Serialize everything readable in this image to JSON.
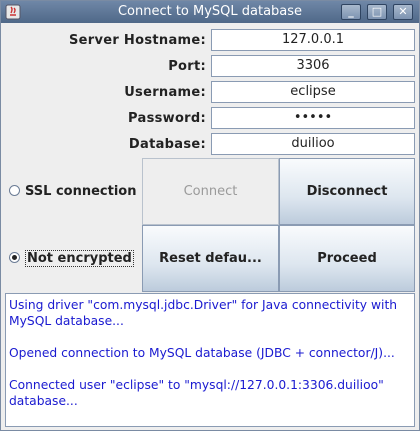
{
  "window": {
    "title": "Connect to MySQL database",
    "minimize": "_",
    "maximize": "□",
    "close": "✕"
  },
  "form": {
    "hostname_label": "Server Hostname:",
    "hostname_value": "127.0.0.1",
    "port_label": "Port:",
    "port_value": "3306",
    "username_label": "Username:",
    "username_value": "eclipse",
    "password_label": "Password:",
    "password_value": "•••••",
    "database_label": "Database:",
    "database_value": "duilioo"
  },
  "options": {
    "ssl_label": "SSL connection",
    "ssl_selected": false,
    "plain_label": "Not encrypted",
    "plain_selected": true
  },
  "buttons": {
    "connect": "Connect",
    "disconnect": "Disconnect",
    "reset": "Reset defau...",
    "proceed": "Proceed"
  },
  "log": [
    "Using driver \"com.mysql.jdbc.Driver\" for Java connectivity with\nMySQL database...",
    "Opened connection to MySQL database (JDBC + connector/J)...",
    "Connected user \"eclipse\" to \"mysql://127.0.0.1:3306.duilioo\"\ndatabase..."
  ]
}
